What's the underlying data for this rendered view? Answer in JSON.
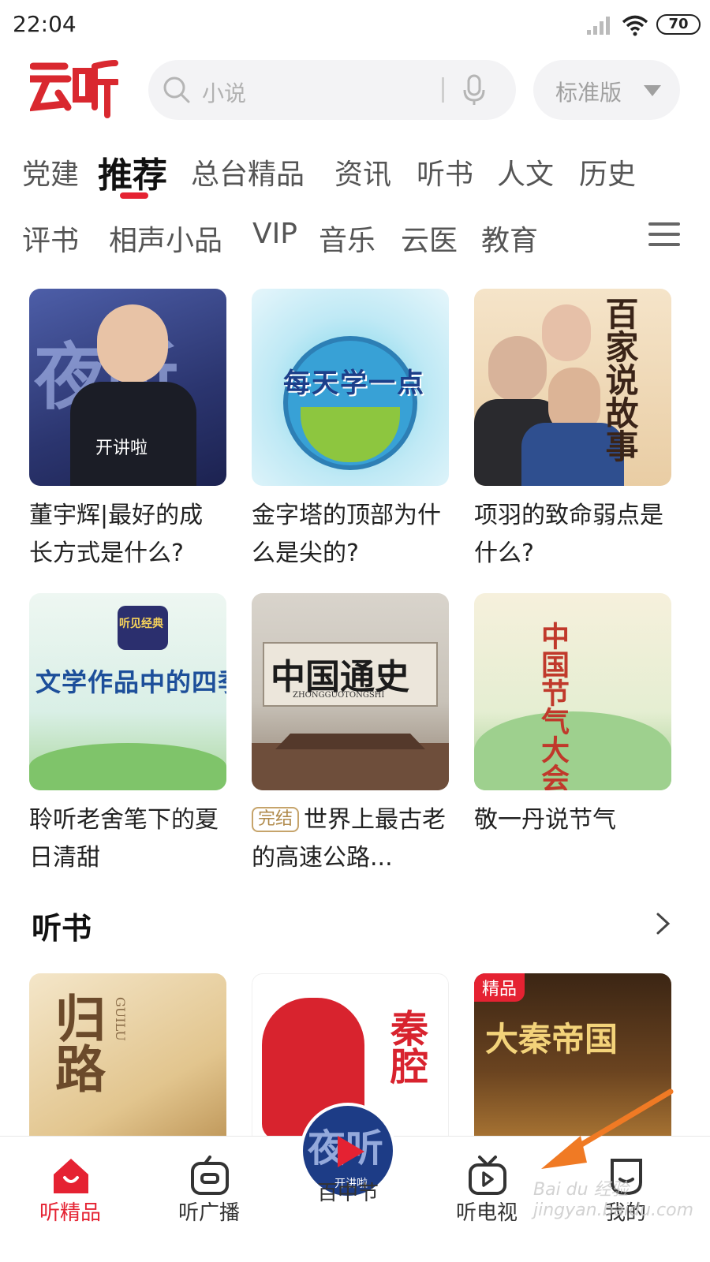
{
  "status_bar": {
    "time": "22:04",
    "battery": "70"
  },
  "header": {
    "logo": "云听",
    "search_placeholder": "小说",
    "edition_label": "标准版"
  },
  "tabs_row1": [
    "党建",
    "推荐",
    "总台精品",
    "资讯",
    "听书",
    "人文",
    "历史"
  ],
  "tabs_row2": [
    "评书",
    "相声小品",
    "VIP",
    "音乐",
    "云医",
    "教育"
  ],
  "active_tab": "推荐",
  "cards": [
    {
      "title": "董宇辉|最好的成长方式是什么?",
      "cover_text": "夜听",
      "cover_sub": "开讲啦"
    },
    {
      "title": "金字塔的顶部为什么是尖的?",
      "cover_text": "每天学一点"
    },
    {
      "title": "项羽的致命弱点是什么?",
      "cover_text": "百家说故事"
    },
    {
      "title": "聆听老舍笔下的夏日清甜",
      "cover_text": "文学作品中的四季",
      "cover_badge": "听见经典"
    },
    {
      "title": "世界上最古老的高速公路...",
      "tag": "完结",
      "cover_text": "中国通史",
      "cover_sub": "ZHONGGUOTONGSHI"
    },
    {
      "title": "敬一丹说节气",
      "cover_text": "中国节气大会"
    }
  ],
  "section": {
    "title": "听书"
  },
  "book_cards": [
    {
      "cover_text": "归路",
      "cover_sub": "GUILU"
    },
    {
      "cover_text": "秦腔"
    },
    {
      "cover_text": "大秦帝国",
      "badge": "精品"
    }
  ],
  "bottom_nav": {
    "items": [
      "听精品",
      "听广播",
      "",
      "听电视",
      "我的"
    ],
    "center_cover_text": "夜听",
    "center_cover_sub": "开讲啦",
    "center_label": "百中节"
  },
  "watermark": "Bai du 经验 jingyan.baidu.com",
  "colors": {
    "brand_red": "#e52232",
    "arrow_orange": "#f07a24"
  }
}
